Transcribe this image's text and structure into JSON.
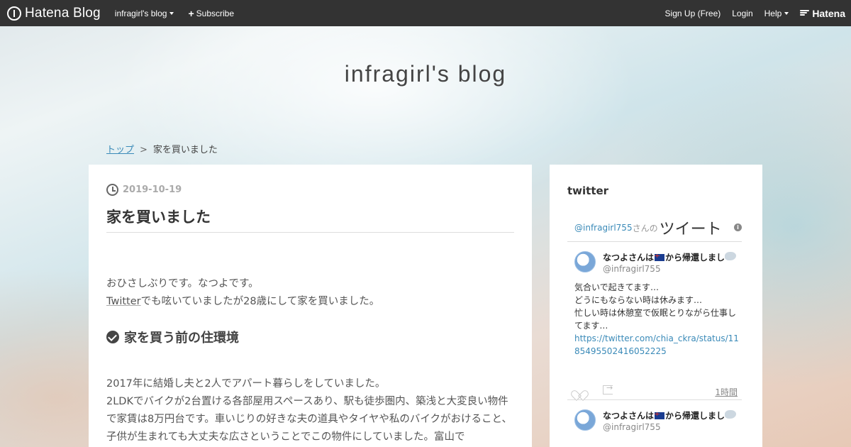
{
  "topbar": {
    "brand": "Hatena Blog",
    "blog_menu": "infragirl's blog",
    "subscribe": "Subscribe",
    "signup": "Sign Up (Free)",
    "login": "Login",
    "help": "Help",
    "hatena": "Hatena"
  },
  "blog": {
    "title": "infragirl's blog"
  },
  "breadcrumb": {
    "top": "トップ",
    "separator": ">",
    "current": "家を買いました"
  },
  "article": {
    "date": "2019-10-19",
    "title": "家を買いました",
    "intro_line1": "おひさしぶりです。なつよです。",
    "intro_line2_link": "Twitter",
    "intro_line2_rest": "でも呟いていましたが28歳にして家を買いました。",
    "section_heading": "家を買う前の住環境",
    "section_para": "2017年に結婚し夫と2人でアパート暮らしをしていました。\n2LDKでバイクが2台置ける各部屋用スペースあり、駅も徒歩圏内、築浅と大変良い物件で家賃は8万円台です。車いじりの好きな夫の道具やタイヤや私のバイクがおけること、子供が生まれても大丈夫な広さということでこの物件にしていました。富山で"
  },
  "sidebar": {
    "title": "twitter",
    "widget": {
      "handle_link": "@infragirl755",
      "san": "さんの",
      "tweets_label": "ツイート",
      "info_icon": "i"
    },
    "tweets": [
      {
        "name": "なつよさんは",
        "name_suffix": "から帰還しまし",
        "handle": "@infragirl755",
        "body_lines": [
          "気合いで起きてます…",
          "どうにもならない時は休みます…",
          "忙しい時は休憩室で仮眠とりながら仕事してます…"
        ],
        "link": "https://twitter.com/chia_ckra/status/1185495502416052225",
        "time": "1時間"
      },
      {
        "name": "なつよさんは",
        "name_suffix": "から帰還しまし",
        "handle": "@infragirl755"
      }
    ]
  },
  "colors": {
    "topbar": "#333333",
    "link": "#3a8ab8"
  }
}
